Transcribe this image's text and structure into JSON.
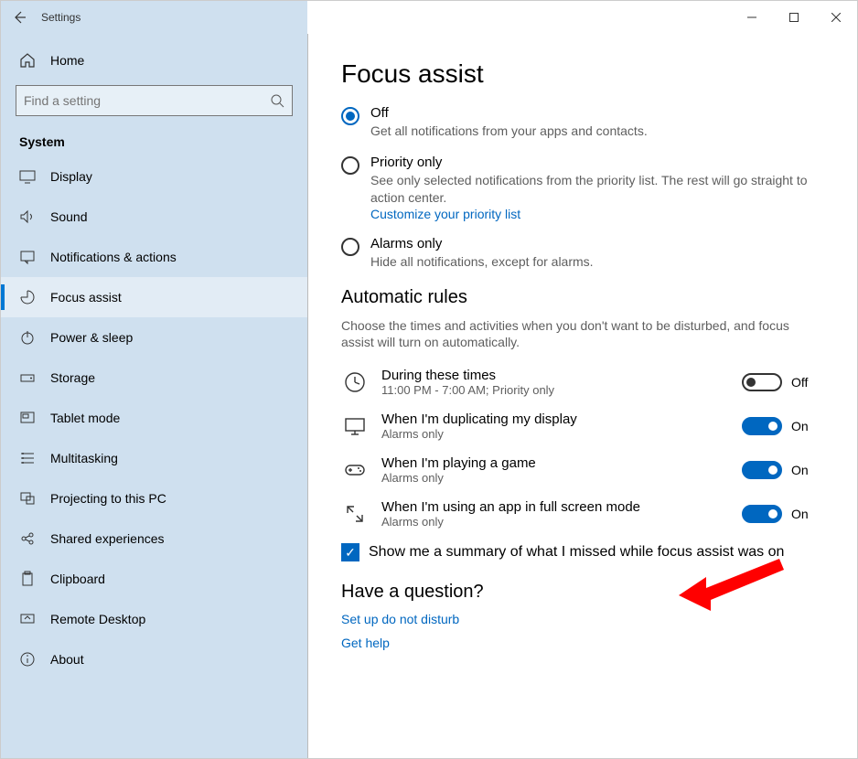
{
  "window": {
    "title": "Settings"
  },
  "sidebar": {
    "home": "Home",
    "search_placeholder": "Find a setting",
    "category": "System",
    "items": [
      {
        "label": "Display"
      },
      {
        "label": "Sound"
      },
      {
        "label": "Notifications & actions"
      },
      {
        "label": "Focus assist"
      },
      {
        "label": "Power & sleep"
      },
      {
        "label": "Storage"
      },
      {
        "label": "Tablet mode"
      },
      {
        "label": "Multitasking"
      },
      {
        "label": "Projecting to this PC"
      },
      {
        "label": "Shared experiences"
      },
      {
        "label": "Clipboard"
      },
      {
        "label": "Remote Desktop"
      },
      {
        "label": "About"
      }
    ]
  },
  "page": {
    "title": "Focus assist",
    "radios": {
      "off": {
        "title": "Off",
        "desc": "Get all notifications from your apps and contacts."
      },
      "priority": {
        "title": "Priority only",
        "desc": "See only selected notifications from the priority list. The rest will go straight to action center.",
        "link": "Customize your priority list"
      },
      "alarms": {
        "title": "Alarms only",
        "desc": "Hide all notifications, except for alarms."
      }
    },
    "rules": {
      "heading": "Automatic rules",
      "desc": "Choose the times and activities when you don't want to be disturbed, and focus assist will turn on automatically.",
      "times": {
        "title": "During these times",
        "sub": "11:00 PM - 7:00 AM; Priority only",
        "state": "Off"
      },
      "dup": {
        "title": "When I'm duplicating my display",
        "sub": "Alarms only",
        "state": "On"
      },
      "game": {
        "title": "When I'm playing a game",
        "sub": "Alarms only",
        "state": "On"
      },
      "fullscreen": {
        "title": "When I'm using an app in full screen mode",
        "sub": "Alarms only",
        "state": "On"
      }
    },
    "checkbox": "Show me a summary of what I missed while focus assist was on",
    "question": {
      "heading": "Have a question?",
      "link1": "Set up do not disturb",
      "link2": "Get help"
    }
  }
}
